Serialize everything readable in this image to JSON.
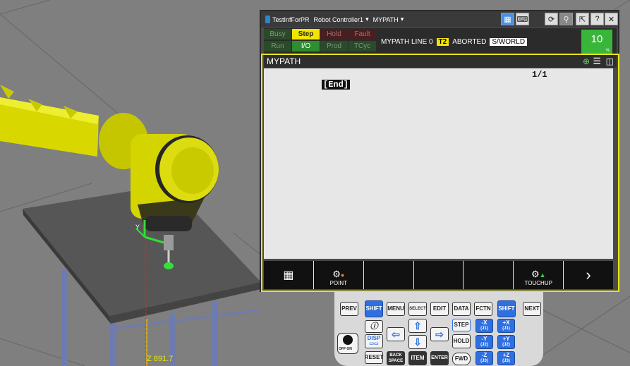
{
  "scene": {
    "coordinate_readout": "Z 891.7",
    "axis_label": "Y"
  },
  "titlebar": {
    "program": "TestInfForPR",
    "controller": "Robot Controller1",
    "path": "MYPATH"
  },
  "status": {
    "leds": [
      "Busy",
      "Step",
      "Hold",
      "Fault",
      "Run",
      "I/O",
      "Prod",
      "TCyc"
    ],
    "line_text": "MYPATH LINE 0",
    "mode": "T2",
    "state": "ABORTED",
    "frame": "S/WORLD",
    "speed_value": "10",
    "speed_unit": "%"
  },
  "program": {
    "title": "MYPATH",
    "position": "1/1",
    "end_marker": "[End]"
  },
  "fkeys": {
    "point_label": "POINT",
    "touchup_label": "TOUCHUP"
  },
  "keypad": {
    "prev": "PREV",
    "shift": "SHIFT",
    "menu": "MENU",
    "select": "SELECT",
    "edit": "EDIT",
    "data": "DATA",
    "fctn": "FCTN",
    "next": "NEXT",
    "disp": "DISP",
    "step": "STEP",
    "hold": "HOLD",
    "reset": "RESET",
    "backspace": "BACK SPACE",
    "item": "ITEM",
    "enter": "ENTER",
    "fwd": "FWD",
    "off_on": "OFF ON",
    "jog": {
      "neg_x": "-X",
      "neg_x_j": "(J1)",
      "pos_x": "+X",
      "pos_x_j": "(J1)",
      "neg_y": "-Y",
      "neg_y_j": "(J2)",
      "pos_y": "+Y",
      "pos_y_j": "(J2)",
      "neg_z": "-Z",
      "neg_z_j": "(J3)",
      "pos_z": "+Z",
      "pos_z_j": "(J3)"
    }
  }
}
